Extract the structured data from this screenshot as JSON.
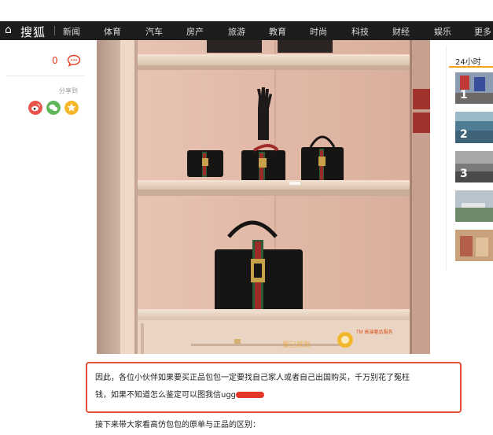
{
  "nav": {
    "home_glyph": "⌂",
    "logo": "搜狐",
    "items": [
      "新闻",
      "体育",
      "汽车",
      "房产",
      "旅游",
      "教育",
      "时尚",
      "科技",
      "财经",
      "娱乐",
      "更多"
    ]
  },
  "left": {
    "comment_count": "0",
    "share_label": "分享到",
    "share_icons": [
      "weibo-icon",
      "wechat-icon",
      "qzone-icon"
    ]
  },
  "right": {
    "title": "24小时",
    "thumbs": [
      "1",
      "2",
      "3",
      "",
      ""
    ]
  },
  "photo": {
    "watermark_text": "TM 高端奢品服务",
    "watermark_text_2": "爱已就到"
  },
  "article": {
    "para1_line1": "因此，各位小伙伴如果要买正品包包一定要找自己家人或者自己出国购买，千万别花了冤枉",
    "para1_line2": "钱，如果不知道怎么鉴定可以图我信ugg",
    "para2": "接下来带大家看高仿包包的原单与正品的区别："
  },
  "colors": {
    "nav_bg": "#1c1c1c",
    "accent_red": "#e35236",
    "right_rule": "#f6a019"
  }
}
